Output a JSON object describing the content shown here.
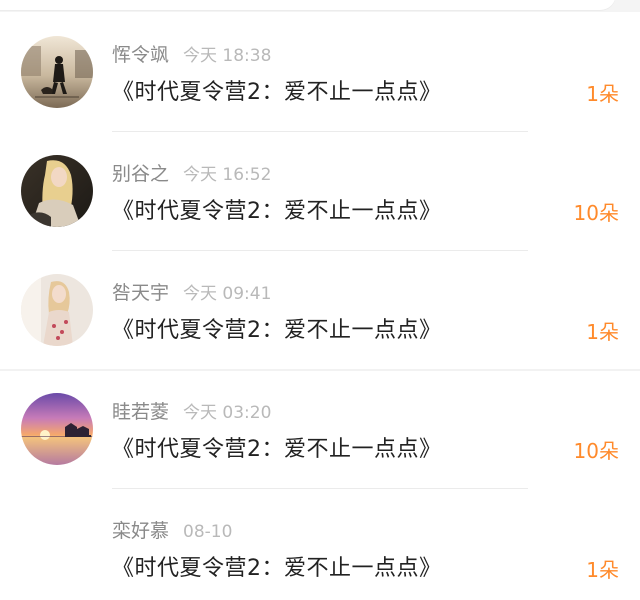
{
  "gifts": [
    {
      "name": "恽令飒",
      "time": "今天 18:38",
      "title": "《时代夏令营2：爱不止一点点》",
      "count": "1朵",
      "avatar": "street-dog-walker-avatar"
    },
    {
      "name": "别谷之",
      "time": "今天 16:52",
      "title": "《时代夏令营2：爱不止一点点》",
      "count": "10朵",
      "avatar": "blonde-woman-avatar"
    },
    {
      "name": "咎天宇",
      "time": "今天 09:41",
      "title": "《时代夏令营2：爱不止一点点》",
      "count": "1朵",
      "avatar": "girl-in-dress-avatar"
    },
    {
      "name": "眭若菱",
      "time": "今天 03:20",
      "title": "《时代夏令营2：爱不止一点点》",
      "count": "10朵",
      "avatar": "sunset-sea-avatar"
    },
    {
      "name": "栾好慕",
      "time": "08-10",
      "title": "《时代夏令营2：爱不止一点点》",
      "count": "1朵",
      "avatar": ""
    }
  ],
  "colors": {
    "accent": "#ff8a2b",
    "name_text": "#8a8a8a",
    "time_text": "#b9b9b9",
    "title_text": "#222222"
  }
}
